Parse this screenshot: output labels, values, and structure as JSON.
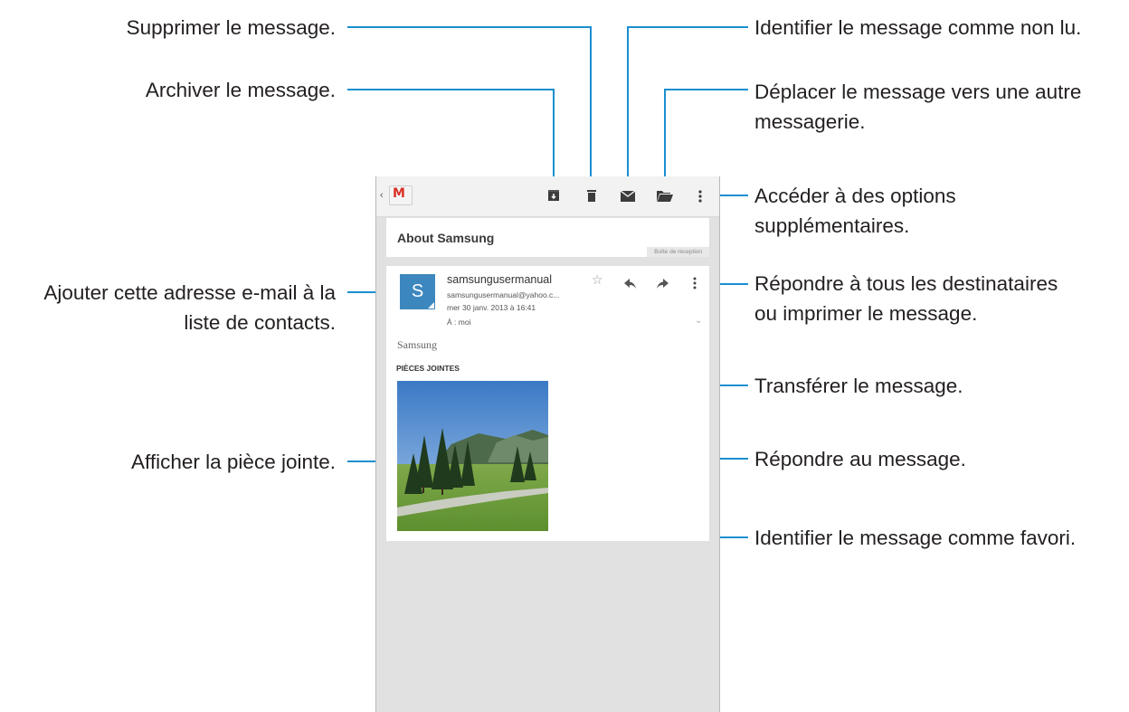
{
  "callouts": {
    "delete": "Supprimer le message.",
    "archive": "Archiver le message.",
    "add_contact_line1": "Ajouter cette adresse e-mail à la",
    "add_contact_line2": "liste de contacts.",
    "view_attachment": "Afficher la pièce jointe.",
    "mark_unread": "Identifier le message comme non lu.",
    "move_line1": "Déplacer le message vers une autre",
    "move_line2": "messagerie.",
    "more_options_line1": "Accéder à des options",
    "more_options_line2": "supplémentaires.",
    "reply_all_line1": "Répondre à tous les destinataires",
    "reply_all_line2": "ou imprimer le message.",
    "forward": "Transférer le message.",
    "reply": "Répondre au message.",
    "favorite": "Identifier le message comme favori."
  },
  "app": {
    "back_glyph": "‹",
    "logo_letter": "M",
    "icons": [
      "archive-icon",
      "delete-icon",
      "mail-unread-icon",
      "folder-move-icon",
      "overflow-menu-icon"
    ]
  },
  "message": {
    "subject": "About Samsung",
    "label": "Boîte de réception",
    "avatar_initial": "S",
    "sender_name": "samsungusermanual",
    "sender_email": "samsungusermanual@yahoo.c...",
    "date": "mer 30 janv. 2013 à 16:41",
    "to": "À : moi",
    "body": "Samsung",
    "attachments_label": "PIÈCES JOINTES"
  },
  "colors": {
    "accent_line": "#1a8fd0",
    "avatar": "#3d87bf",
    "gmail_red": "#d93025"
  }
}
